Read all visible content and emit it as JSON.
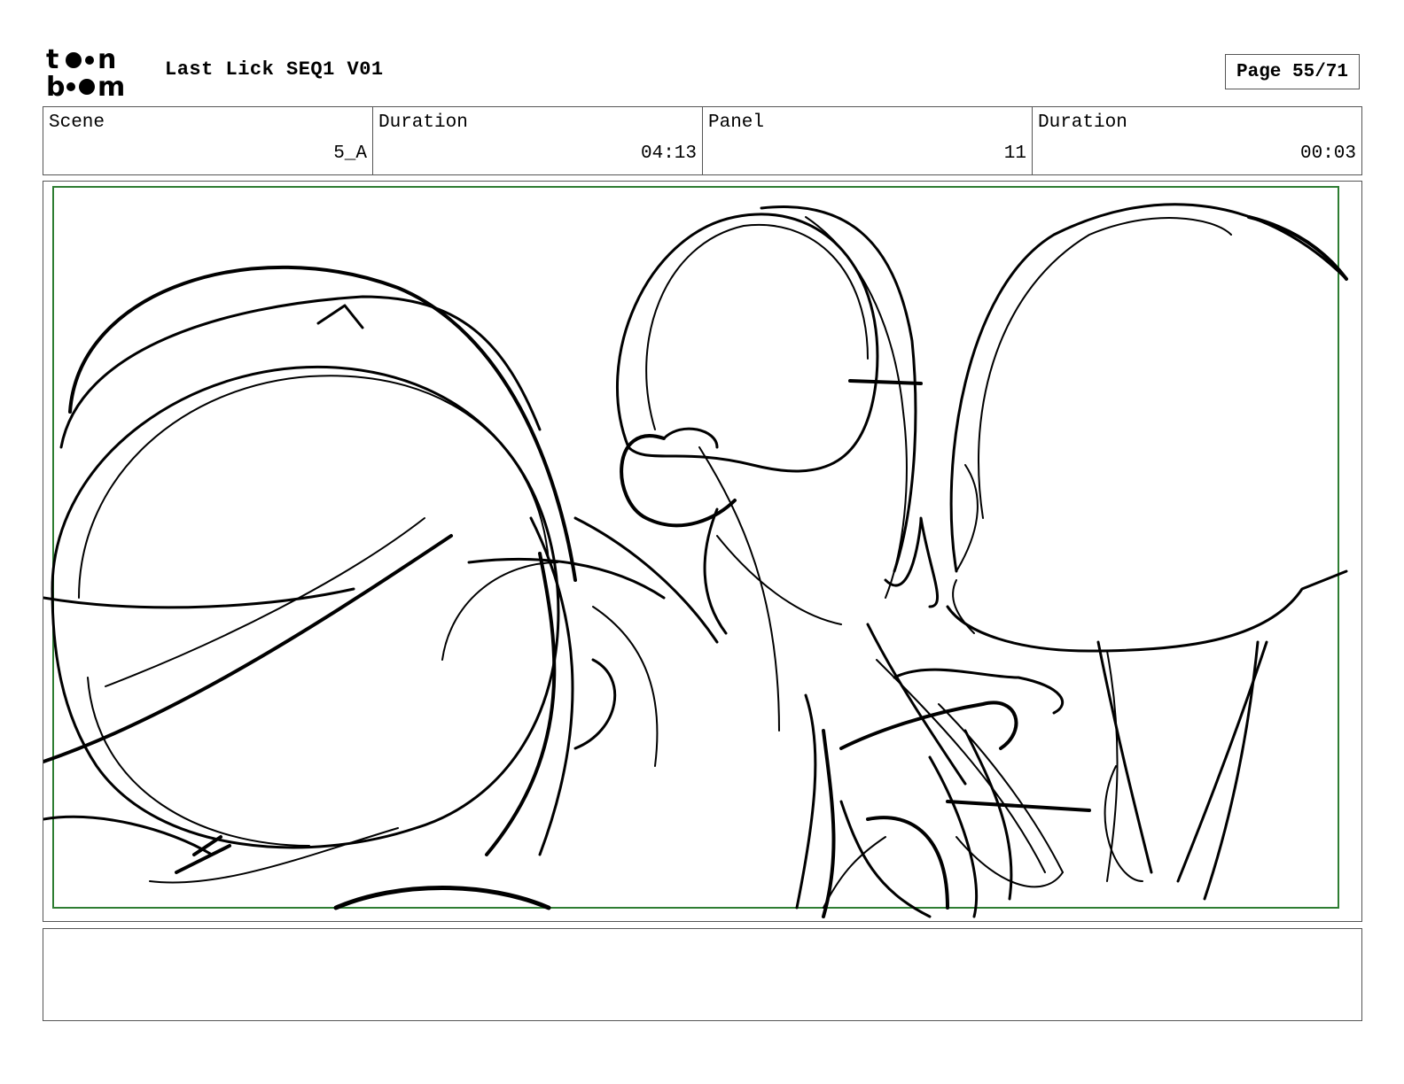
{
  "header": {
    "logo_text": "toon boom",
    "title": "Last Lick SEQ1 V01",
    "page_label": "Page 55/71"
  },
  "info": [
    {
      "label": "Scene",
      "value": "5_A"
    },
    {
      "label": "Duration",
      "value": "04:13"
    },
    {
      "label": "Panel",
      "value": "11"
    },
    {
      "label": "Duration",
      "value": "00:03"
    }
  ],
  "panel": {
    "safe_frame_color": "#2e7d32",
    "sketch_color": "#000000"
  },
  "notes": {
    "text": ""
  }
}
